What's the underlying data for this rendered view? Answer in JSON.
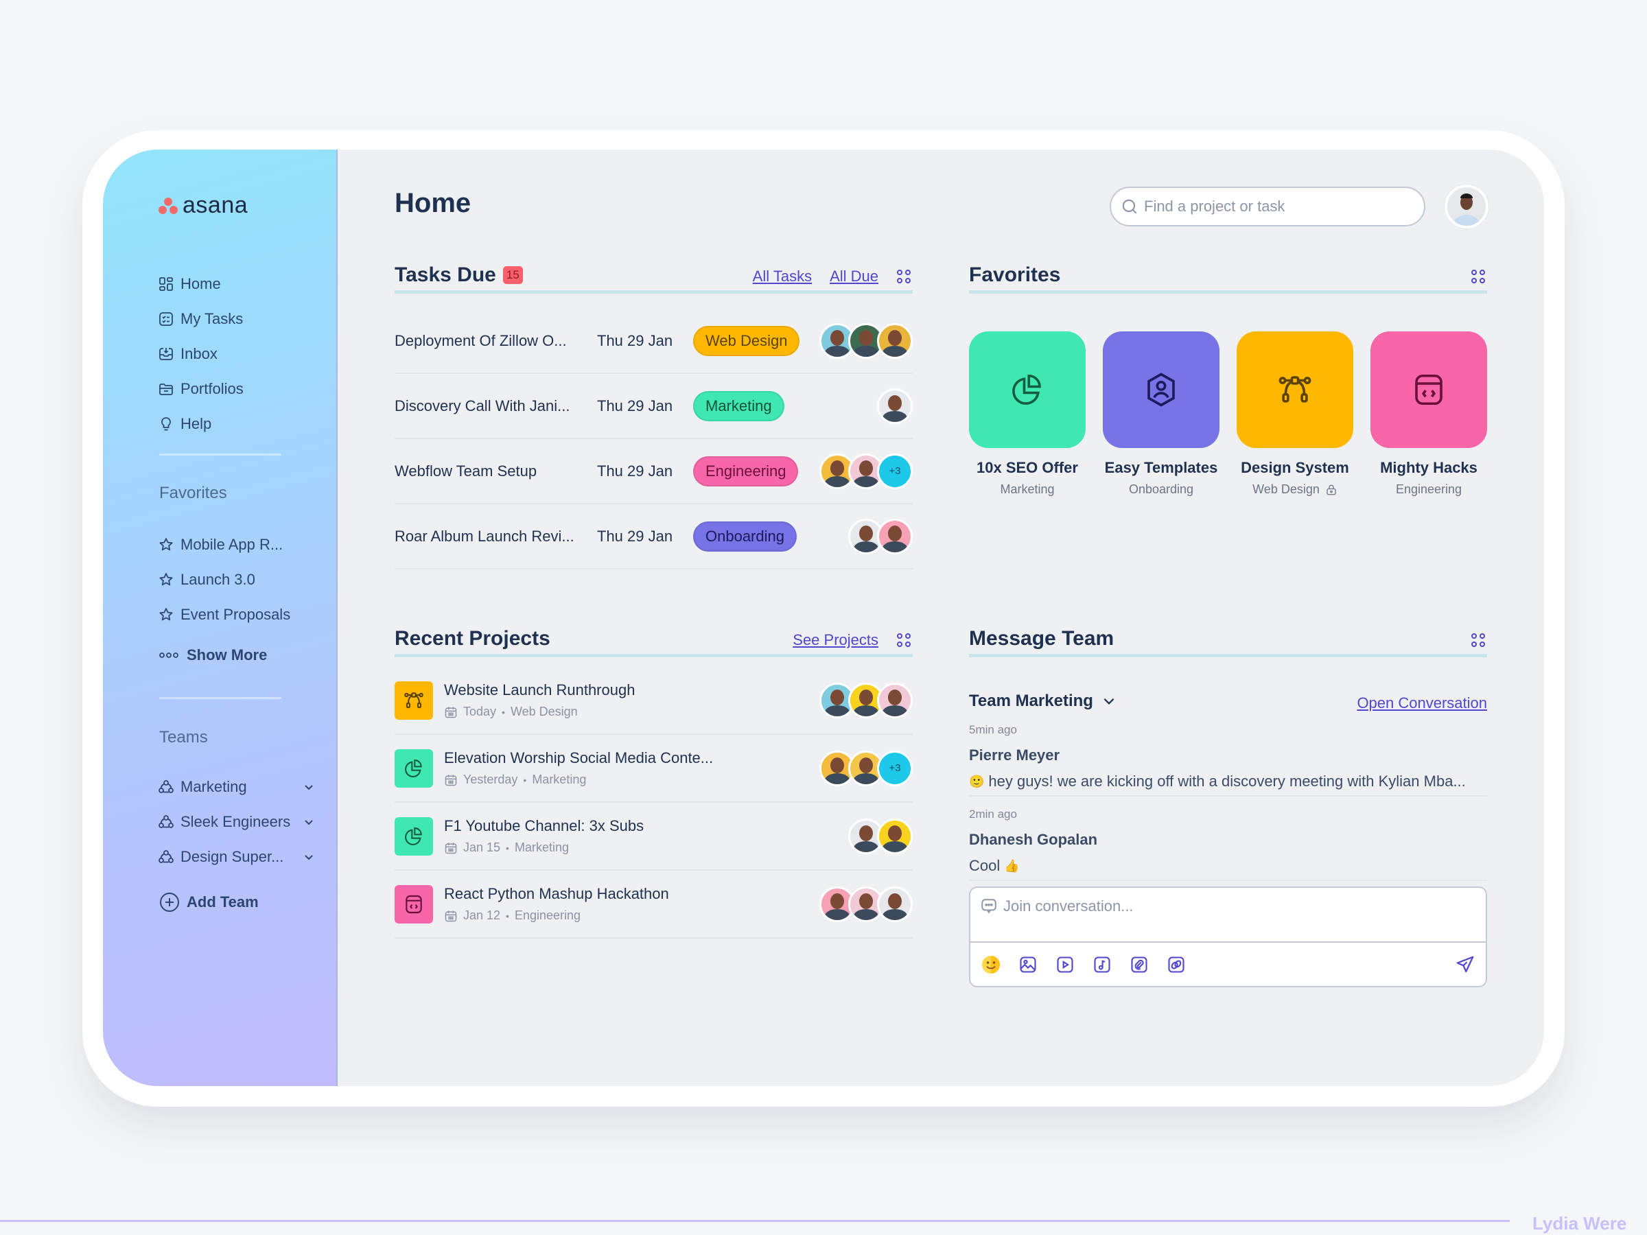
{
  "app": {
    "logo_text": "asana"
  },
  "sidebar": {
    "nav": [
      {
        "label": "Home",
        "icon": "home-grid-icon"
      },
      {
        "label": "My Tasks",
        "icon": "task-list-icon"
      },
      {
        "label": "Inbox",
        "icon": "inbox-icon"
      },
      {
        "label": "Portfolios",
        "icon": "folder-icon"
      },
      {
        "label": "Help",
        "icon": "lightbulb-icon"
      }
    ],
    "favorites_label": "Favorites",
    "favorites": [
      {
        "label": "Mobile App R..."
      },
      {
        "label": "Launch 3.0"
      },
      {
        "label": "Event Proposals"
      }
    ],
    "show_more": "Show More",
    "teams_label": "Teams",
    "teams": [
      {
        "label": "Marketing"
      },
      {
        "label": "Sleek Engineers"
      },
      {
        "label": "Design Super..."
      }
    ],
    "add_team": "Add Team"
  },
  "header": {
    "title": "Home",
    "search_placeholder": "Find a project or task"
  },
  "tasks_due": {
    "title": "Tasks Due",
    "count": "15",
    "links": [
      "All Tasks",
      "All Due"
    ],
    "rows": [
      {
        "name": "Deployment Of Zillow O...",
        "date": "Thu 29 Jan",
        "tag": "Web Design",
        "tag_color": "#ffb700",
        "tag_text": "#5a4300",
        "avatars": [
          "#7fcbe0",
          "#3d6b4f",
          "#e8b43a"
        ],
        "extra": ""
      },
      {
        "name": "Discovery Call With Jani...",
        "date": "Thu 29 Jan",
        "tag": "Marketing",
        "tag_color": "#3ee8b0",
        "tag_text": "#11513c",
        "avatars": [
          "#e6e8ec"
        ],
        "extra": ""
      },
      {
        "name": "Webflow Team Setup",
        "date": "Thu 29 Jan",
        "tag": "Engineering",
        "tag_color": "#f766a8",
        "tag_text": "#6b0f3a",
        "avatars": [
          "#f4bb3c",
          "#f2c9d6"
        ],
        "extra": "+3"
      },
      {
        "name": "Roar Album Launch Revi...",
        "date": "Thu 29 Jan",
        "tag": "Onboarding",
        "tag_color": "#7673e6",
        "tag_text": "#1c1a5a",
        "avatars": [
          "#e6e8ec",
          "#f7a1b4"
        ],
        "extra": ""
      }
    ]
  },
  "favorites": {
    "title": "Favorites",
    "items": [
      {
        "name": "10x SEO Offer",
        "sub": "Marketing",
        "color": "#3ee8b0",
        "icon": "pie-chart-icon",
        "locked": false
      },
      {
        "name": "Easy Templates",
        "sub": "Onboarding",
        "color": "#7673e6",
        "icon": "user-hexagon-icon",
        "locked": false
      },
      {
        "name": "Design System",
        "sub": "Web Design",
        "color": "#ffb700",
        "icon": "bezier-icon",
        "locked": true
      },
      {
        "name": "Mighty Hacks",
        "sub": "Engineering",
        "color": "#f766a8",
        "icon": "code-window-icon",
        "locked": false
      }
    ]
  },
  "recent_projects": {
    "title": "Recent Projects",
    "link": "See Projects",
    "rows": [
      {
        "name": "Website Launch Runthrough",
        "when": "Today",
        "team": "Web Design",
        "color": "#ffb700",
        "icon": "bezier-icon",
        "avatars": [
          "#7fcbe0",
          "#f8d21c",
          "#f2c9d6"
        ],
        "extra": ""
      },
      {
        "name": "Elevation Worship Social Media Conte...",
        "when": "Yesterday",
        "team": "Marketing",
        "color": "#3ee8b0",
        "icon": "pie-chart-icon",
        "avatars": [
          "#f4bb3c",
          "#f4c64a"
        ],
        "extra": "+3"
      },
      {
        "name": "F1 Youtube Channel: 3x Subs",
        "when": "Jan 15",
        "team": "Marketing",
        "color": "#3ee8b0",
        "icon": "pie-chart-icon",
        "avatars": [
          "#e6e8ec",
          "#f8d21c"
        ],
        "extra": ""
      },
      {
        "name": "React Python Mashup Hackathon",
        "when": "Jan 12",
        "team": "Engineering",
        "color": "#f766a8",
        "icon": "code-window-icon",
        "avatars": [
          "#f7a1b4",
          "#f2c9d6",
          "#e6e8ec"
        ],
        "extra": ""
      }
    ]
  },
  "message_team": {
    "title": "Message Team",
    "team": "Team Marketing",
    "open_link": "Open Conversation",
    "messages": [
      {
        "time": "5min ago",
        "author": "Pierre Meyer",
        "emoji": "🙂",
        "text": "hey guys! we are kicking off with a discovery meeting with Kylian Mba..."
      },
      {
        "time": "2min ago",
        "author": "Dhanesh Gopalan",
        "emoji": "👍",
        "text": "Cool"
      }
    ],
    "composer_placeholder": "Join conversation...",
    "tools": [
      "emoji-icon",
      "image-icon",
      "video-icon",
      "music-icon",
      "attachment-icon",
      "link-icon"
    ]
  },
  "colors": {
    "accent": "#5046cf",
    "badge": "#fb5f6b",
    "plus_avatar": "#1ec8e8"
  },
  "watermark": "Lydia Were"
}
